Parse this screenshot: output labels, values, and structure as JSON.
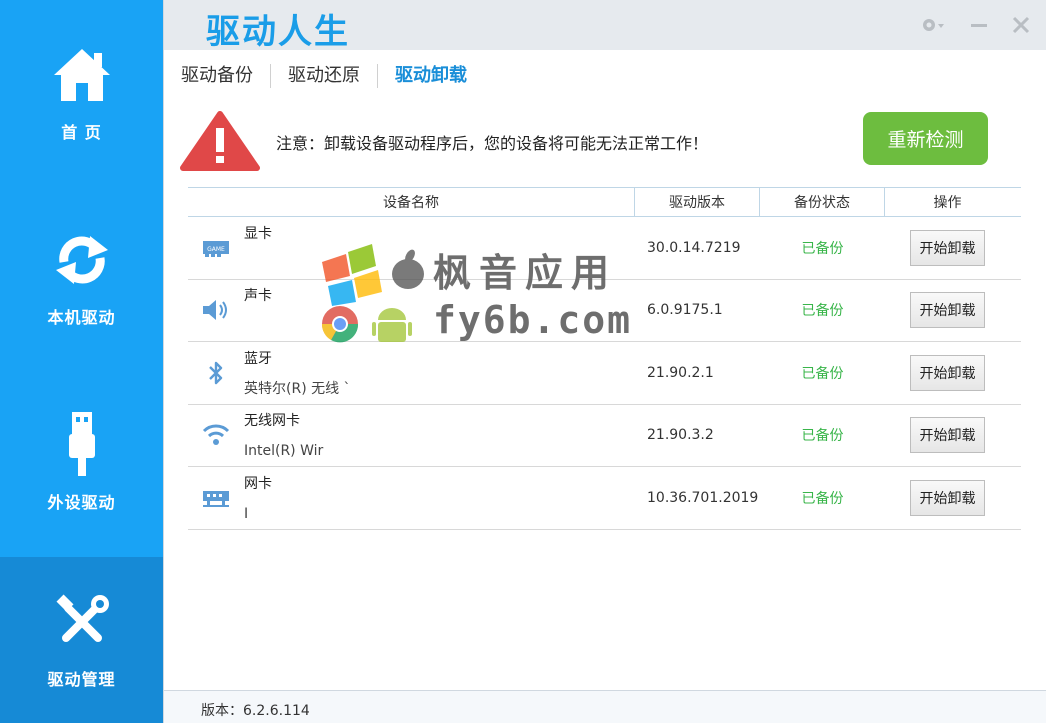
{
  "app": {
    "title": "驱动人生",
    "version_text": "版本：6.2.6.114"
  },
  "sidebar": {
    "items": [
      {
        "label": "首 页",
        "icon": "home-icon"
      },
      {
        "label": "本机驱动",
        "icon": "refresh-icon"
      },
      {
        "label": "外设驱动",
        "icon": "usb-icon"
      },
      {
        "label": "驱动管理",
        "icon": "tools-icon",
        "active": true
      }
    ]
  },
  "tabs": [
    {
      "label": "驱动备份"
    },
    {
      "label": "驱动还原"
    },
    {
      "label": "驱动卸载",
      "active": true
    }
  ],
  "warning": {
    "text": "注意：卸载设备驱动程序后，您的设备将可能无法正常工作！"
  },
  "recheck_button": "重新检测",
  "table": {
    "headers": [
      "设备名称",
      "驱动版本",
      "备份状态",
      "操作"
    ],
    "rows": [
      {
        "name": "显卡",
        "desc": "",
        "version": "30.0.14.7219",
        "status": "已备份",
        "action": "开始卸载",
        "icon": "gpu-icon"
      },
      {
        "name": "声卡",
        "desc": "",
        "version": "6.0.9175.1",
        "status": "已备份",
        "action": "开始卸载",
        "icon": "speaker-icon"
      },
      {
        "name": "蓝牙",
        "desc": "英特尔(R) 无线 `",
        "version": "21.90.2.1",
        "status": "已备份",
        "action": "开始卸载",
        "icon": "bluetooth-icon"
      },
      {
        "name": "无线网卡",
        "desc": "Intel(R) Wir",
        "version": "21.90.3.2",
        "status": "已备份",
        "action": "开始卸载",
        "icon": "wifi-icon"
      },
      {
        "name": "网卡",
        "desc": "I",
        "version": "10.36.701.2019",
        "status": "已备份",
        "action": "开始卸载",
        "icon": "ethernet-icon"
      }
    ]
  },
  "watermark": {
    "line1": "枫音应用",
    "line2": "fy6b.com"
  },
  "colors": {
    "sidebar": "#19a3f5",
    "sidebar_active": "#168ad6",
    "accent": "#1a9de8",
    "green_button": "#6dbd3f",
    "status_green": "#39b54a",
    "warning_red": "#e04848"
  }
}
